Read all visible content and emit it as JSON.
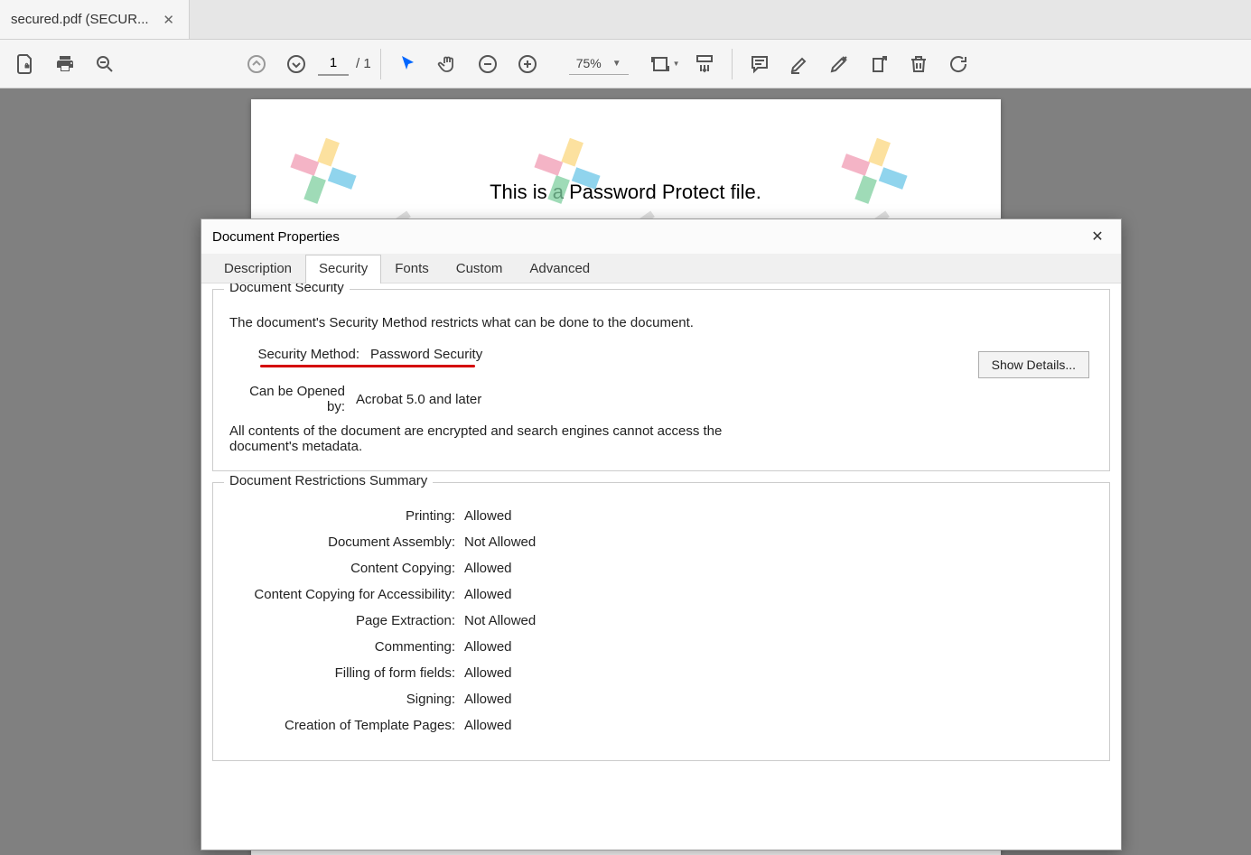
{
  "tab": {
    "title": "secured.pdf (SECUR..."
  },
  "toolbar": {
    "page_current": "1",
    "page_total": "/ 1",
    "zoom": "75%"
  },
  "page": {
    "text": "This is a Password Protect file."
  },
  "dialog": {
    "title": "Document Properties",
    "tabs": [
      "Description",
      "Security",
      "Fonts",
      "Custom",
      "Advanced"
    ],
    "security": {
      "section_title": "Document Security",
      "description": "The document's Security Method restricts what can be done to the document.",
      "method_label": "Security Method:",
      "method_value": "Password Security",
      "open_label": "Can be Opened by:",
      "open_value": "Acrobat 5.0 and later",
      "meta_note": "All contents of the document are encrypted and search engines cannot access the document's metadata.",
      "show_details": "Show Details..."
    },
    "restrictions": {
      "section_title": "Document Restrictions Summary",
      "items": [
        {
          "label": "Printing:",
          "value": "Allowed"
        },
        {
          "label": "Document Assembly:",
          "value": "Not Allowed"
        },
        {
          "label": "Content Copying:",
          "value": "Allowed"
        },
        {
          "label": "Content Copying for Accessibility:",
          "value": "Allowed"
        },
        {
          "label": "Page Extraction:",
          "value": "Not Allowed"
        },
        {
          "label": "Commenting:",
          "value": "Allowed"
        },
        {
          "label": "Filling of form fields:",
          "value": "Allowed"
        },
        {
          "label": "Signing:",
          "value": "Allowed"
        },
        {
          "label": "Creation of Template Pages:",
          "value": "Allowed"
        }
      ]
    }
  }
}
